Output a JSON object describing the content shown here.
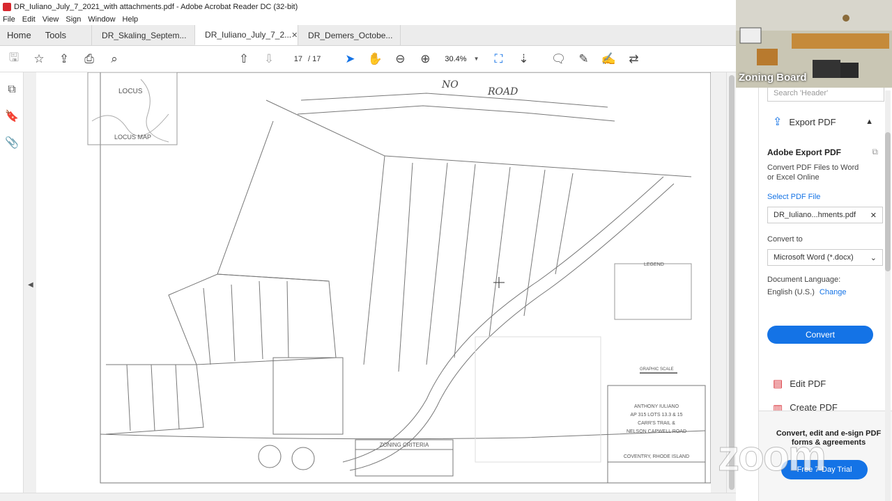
{
  "window": {
    "title": "DR_Iuliano_July_7_2021_with attachments.pdf - Adobe Acrobat Reader DC (32-bit)"
  },
  "menu": [
    "File",
    "Edit",
    "View",
    "Sign",
    "Window",
    "Help"
  ],
  "nav_tabs": [
    "Home",
    "Tools"
  ],
  "doc_tabs": [
    {
      "label": "DR_Skaling_Septem...",
      "active": false
    },
    {
      "label": "DR_Iuliano_July_7_2...",
      "active": true
    },
    {
      "label": "DR_Demers_Octobe...",
      "active": false
    }
  ],
  "toolbar": {
    "current_page": "17",
    "total_pages": "/ 17",
    "zoom": "30.4%"
  },
  "video": {
    "label": "Zoning Board"
  },
  "panel": {
    "search_placeholder": "Search 'Header'",
    "export_section": "Export PDF",
    "title": "Adobe Export PDF",
    "description": "Convert PDF Files to Word or Excel Online",
    "select_link": "Select PDF File",
    "file_name": "DR_Iuliano...hments.pdf",
    "convert_to_label": "Convert to",
    "convert_to_value": "Microsoft Word (*.docx)",
    "language_label": "Document Language:",
    "language_value": "English (U.S.)",
    "language_change": "Change",
    "convert_button": "Convert",
    "edit_pdf": "Edit PDF",
    "create_pdf": "Create PDF",
    "promo_text": "Convert, edit and e-sign PDF forms & agreements",
    "trial_button": "Free 7-Day Trial"
  },
  "plan": {
    "locus_label": "LOCUS",
    "locus_map_label": "LOCUS MAP",
    "handwritten_1": "NO",
    "handwritten_2": "ROAD",
    "legend_title": "LEGEND",
    "title_block_lines": [
      "ANTHONY IULIANO",
      "AP 315 LOTS 13.3 & 15",
      "CARR'S TRAIL &",
      "NELSON CAPWELL ROAD"
    ],
    "location": "COVENTRY, RHODE ISLAND",
    "zoning_title": "ZONING CRITERIA",
    "graphic_scale": "GRAPHIC SCALE"
  },
  "watermark": "zoom",
  "colors": {
    "accent": "#1473e6",
    "adobe_red": "#d7282f"
  }
}
